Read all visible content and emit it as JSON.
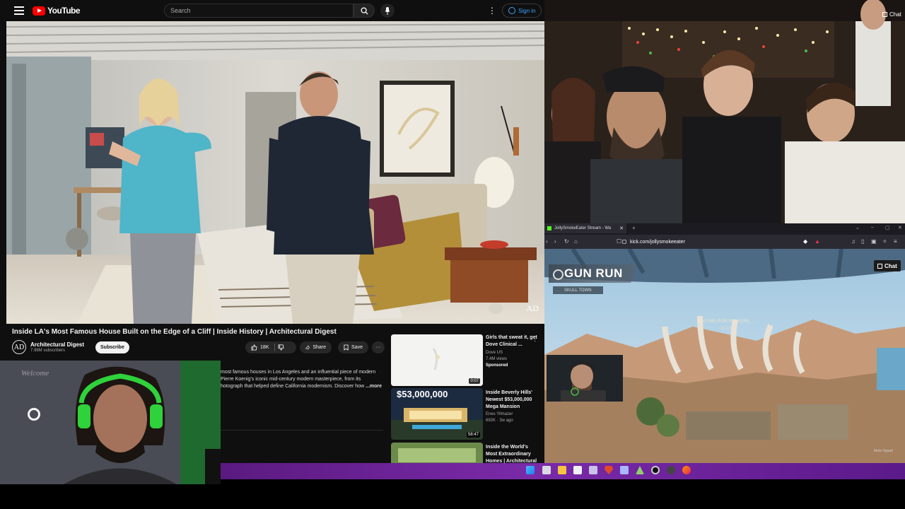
{
  "youtube": {
    "logo_text": "YouTube",
    "search_placeholder": "Search",
    "sign_in": "Sign in",
    "video_title": "Inside LA's Most Famous House Built on the Edge of a Cliff | Inside History | Architectural Digest",
    "watermark": "AD",
    "channel": {
      "avatar_letter": "AD",
      "name": "Architectural Digest",
      "subscribers": "7.98M subscribers",
      "subscribe_label": "Subscribe"
    },
    "actions": {
      "likes": "18K",
      "share": "Share",
      "save": "Save"
    },
    "description": {
      "line1": "most famous houses in Los Angeles and an influential piece of modern",
      "line2": "Pierre Koenig's iconic mid-century modern masterpiece, from its",
      "line3": "hotograph that helped define California modernism. Discover how",
      "more": "...more"
    },
    "recommendations": [
      {
        "title": "Girls that sweat it, get Dove Clinical ...",
        "channel": "Dove US",
        "meta": "7.4M views",
        "badge": "Sponsored",
        "duration": "0:07"
      },
      {
        "title": "Inside Beverly Hills' Newest $53,000,000 Mega Mansion",
        "channel": "Enes Yilmazer",
        "meta": "692K · 3w ago",
        "duration": "58:47",
        "thumb_text": "$53,000,000"
      },
      {
        "title": "Inside the World's Most Extraordinary Homes | Architectural Digest"
      }
    ]
  },
  "stream_top": {
    "chat_label": "Chat"
  },
  "browser": {
    "tab_title": "JollySmokeEater Stream - Wa",
    "url": "kick.com/jollysmokeeater",
    "game": {
      "mode": "GUN RUN",
      "map": "SKULL TOWN",
      "status": "WAITING FOR PLAYERS...",
      "count": "11/12",
      "chat_label": "Chat",
      "squad": "Mute Squad"
    }
  },
  "webcam": {
    "sign_text": "Welcome"
  },
  "colors": {
    "youtube_bg": "#0f0f0f",
    "youtube_red": "#ff0000",
    "link_blue": "#3ea6ff",
    "taskbar_purple": "#7a2aa8",
    "kick_green": "#53fc18"
  }
}
